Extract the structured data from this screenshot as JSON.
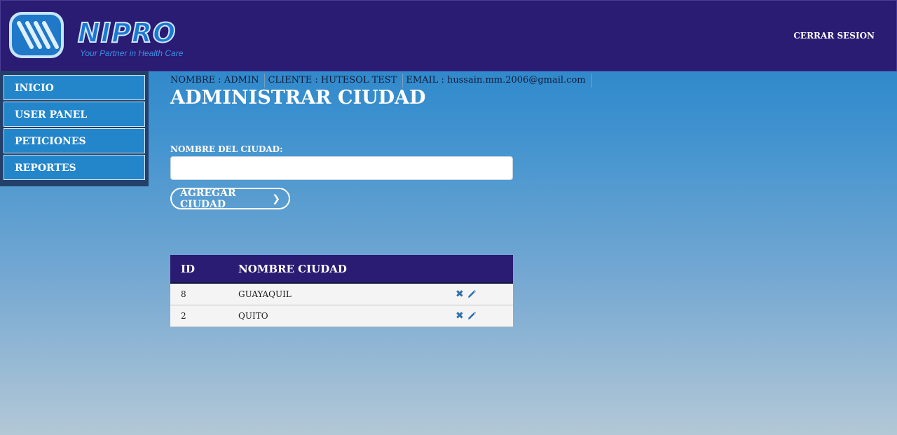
{
  "header": {
    "logo_text": "NIPRO",
    "logo_tagline": "Your Partner in Health Care",
    "logout_label": "CERRAR SESION"
  },
  "sidebar": {
    "items": [
      {
        "label": "INICIO"
      },
      {
        "label": "USER PANEL"
      },
      {
        "label": "PETICIONES"
      },
      {
        "label": "REPORTES"
      }
    ]
  },
  "user_info": {
    "nombre": "NOMBRE : ADMIN",
    "cliente": "CLIENTE : HUTESOL TEST",
    "email": "EMAIL : hussain.mm.2006@gmail.com"
  },
  "page": {
    "title": "ADMINISTRAR CIUDAD",
    "field_label": "NOMBRE DEL CIUDAD:",
    "field_value": "",
    "add_button": "AGREGAR CIUDAD"
  },
  "table": {
    "headers": {
      "id": "ID",
      "name": "NOMBRE CIUDAD"
    },
    "rows": [
      {
        "id": "8",
        "name": "GUAYAQUIL"
      },
      {
        "id": "2",
        "name": "QUITO"
      }
    ]
  },
  "icons": {
    "delete": "close-icon",
    "edit": "pencil-icon",
    "chevron": "chevron-right-icon"
  }
}
